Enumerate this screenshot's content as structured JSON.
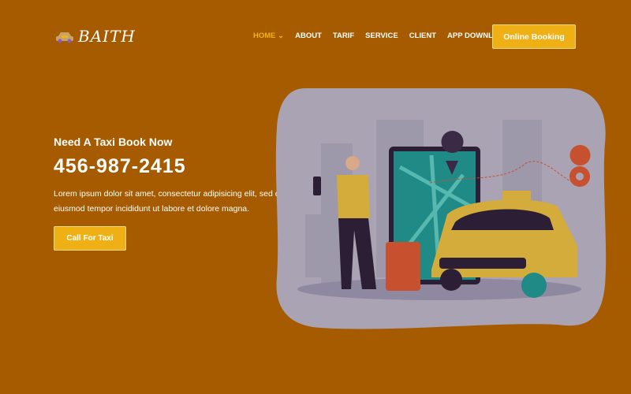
{
  "brand": {
    "name": "BAITH",
    "logo_icon": "taxi-icon"
  },
  "nav": {
    "items": [
      {
        "label": "HOME",
        "active": true,
        "icon": "chevron-down-icon"
      },
      {
        "label": "ABOUT"
      },
      {
        "label": "TARIF"
      },
      {
        "label": "SERVICE"
      },
      {
        "label": "CLIENT"
      },
      {
        "label": "APP DOWNLOAD"
      }
    ],
    "cta": "Online Booking"
  },
  "hero": {
    "subtitle": "Need A Taxi Book Now",
    "phone": "456-987-2415",
    "description": "Lorem ipsum dolor sit amet, consectetur adipisicing elit, sed do eiusmod tempor incididunt ut labore et dolore magna.",
    "button": "Call For Taxi"
  },
  "colors": {
    "background": "#a65b00",
    "accent": "#efb016",
    "illustration_bg": "#a9a3b3"
  }
}
